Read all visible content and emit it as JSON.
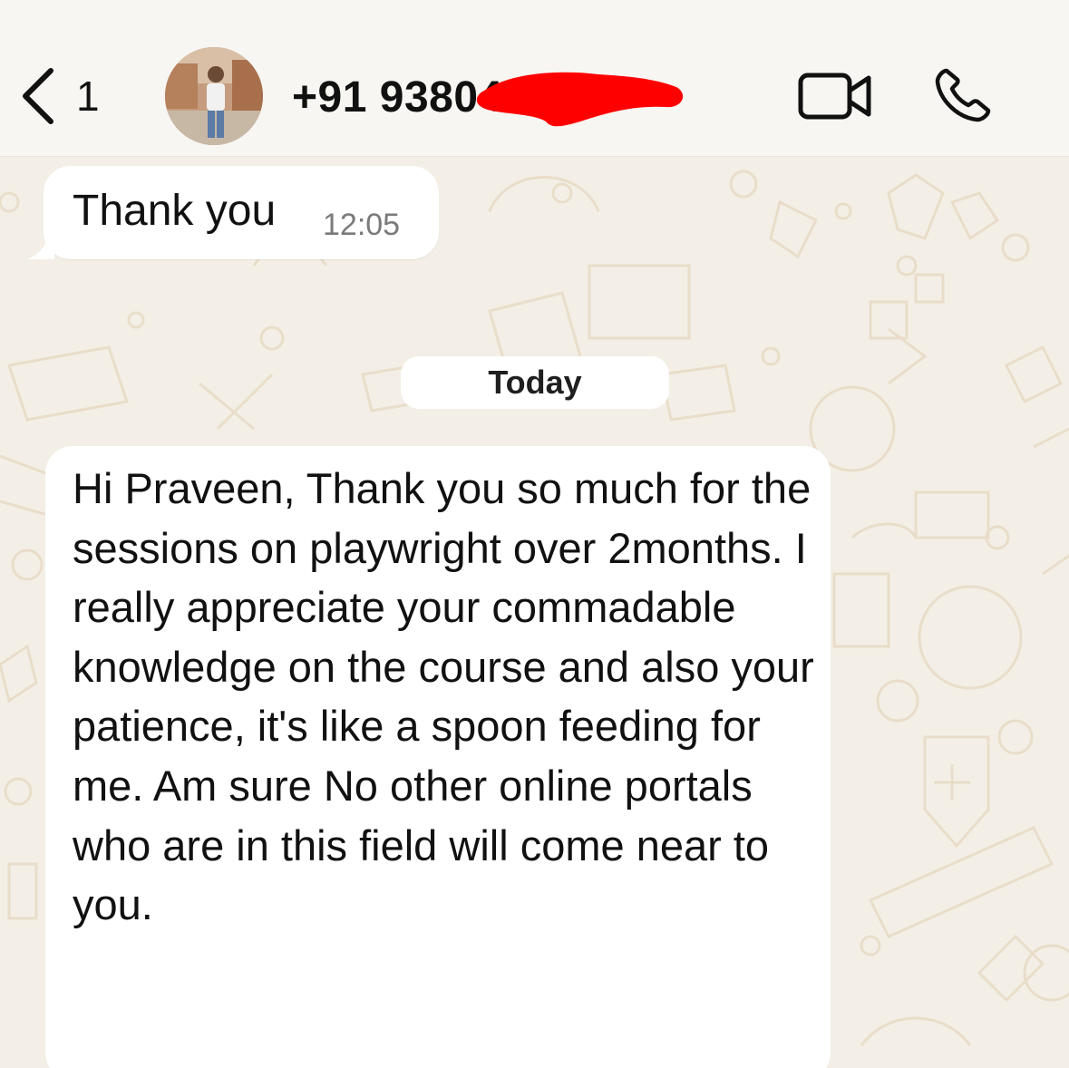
{
  "header": {
    "back_count": "1",
    "contact_name": "+91 93804",
    "icons": {
      "back": "chevron-left-icon",
      "video": "video-camera-icon",
      "call": "phone-icon"
    }
  },
  "chat": {
    "messages": [
      {
        "direction": "incoming",
        "text": "Thank you",
        "time": "12:05"
      },
      {
        "direction": "incoming",
        "text": "Hi Praveen, Thank you so much for the sessions on playwright over 2months. I really appreciate your commadable  knowledge on the course and also your patience, it's like a spoon feeding for me. Am sure No other online portals who are in this field will come near to you.",
        "time": ""
      }
    ],
    "date_separator": "Today"
  },
  "colors": {
    "wallpaper": "#f3efe6",
    "bubble": "#ffffff",
    "header": "#f7f6f2",
    "redaction": "#ff0000"
  }
}
